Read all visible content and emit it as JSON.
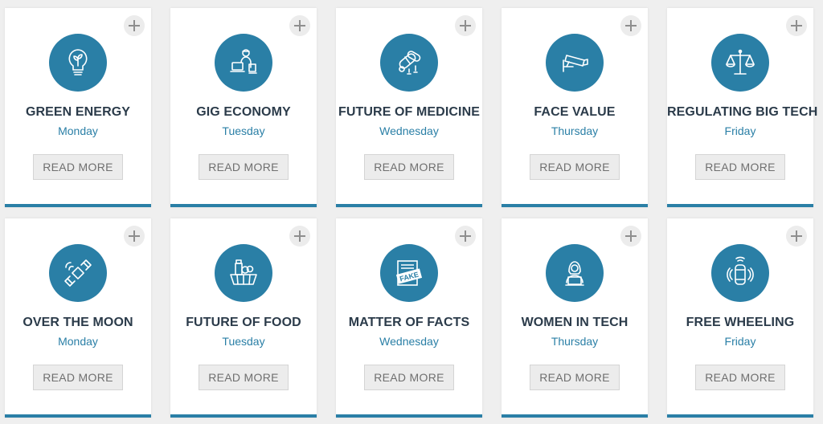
{
  "colors": {
    "accent": "#2a7fa6",
    "title_text": "#2b3b4a",
    "button_bg": "#ececec",
    "page_bg": "#efefef"
  },
  "cards": [
    {
      "title": "GREEN ENERGY",
      "day": "Monday",
      "button_label": "READ MORE",
      "icon": "lightbulb-leaf-icon"
    },
    {
      "title": "GIG ECONOMY",
      "day": "Tuesday",
      "button_label": "READ MORE",
      "icon": "delivery-worker-icon"
    },
    {
      "title": "FUTURE OF MEDICINE",
      "day": "Wednesday",
      "button_label": "READ MORE",
      "icon": "pills-icon"
    },
    {
      "title": "FACE VALUE",
      "day": "Thursday",
      "button_label": "READ MORE",
      "icon": "security-camera-icon"
    },
    {
      "title": "REGULATING BIG TECH",
      "day": "Friday",
      "button_label": "READ MORE",
      "icon": "scales-icon"
    },
    {
      "title": "OVER THE MOON",
      "day": "Monday",
      "button_label": "READ MORE",
      "icon": "satellite-icon"
    },
    {
      "title": "FUTURE OF FOOD",
      "day": "Tuesday",
      "button_label": "READ MORE",
      "icon": "food-basket-icon"
    },
    {
      "title": "MATTER OF FACTS",
      "day": "Wednesday",
      "button_label": "READ MORE",
      "icon": "fake-news-icon",
      "icon_text": "FAKE"
    },
    {
      "title": "WOMEN IN TECH",
      "day": "Thursday",
      "button_label": "READ MORE",
      "icon": "woman-laptop-icon"
    },
    {
      "title": "FREE WHEELING",
      "day": "Friday",
      "button_label": "READ MORE",
      "icon": "autonomous-car-icon"
    }
  ]
}
